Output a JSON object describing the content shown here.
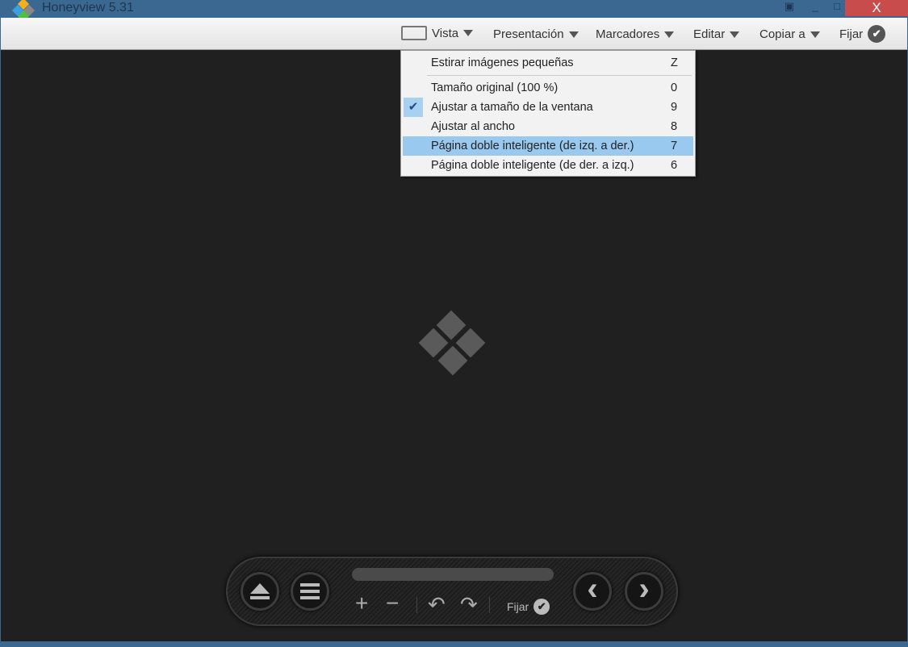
{
  "app": {
    "title": "Honeyview 5.31"
  },
  "window": {
    "close": "X",
    "minimize": "_",
    "maximize": "□",
    "restore": "▣"
  },
  "toolbar": {
    "vista": "Vista",
    "presentacion": "Presentación",
    "marcadores": "Marcadores",
    "editar": "Editar",
    "copiar": "Copiar a",
    "fijar": "Fijar"
  },
  "menu": {
    "items": [
      {
        "label": "Estirar imágenes pequeñas",
        "key": "Z"
      },
      {
        "label": "Tamaño original (100 %)",
        "key": "0"
      },
      {
        "label": "Ajustar a tamaño de la ventana",
        "key": "9",
        "checked": true
      },
      {
        "label": "Ajustar al ancho",
        "key": "8"
      },
      {
        "label": "Página doble inteligente (de izq. a der.)",
        "key": "7",
        "highlighted": true
      },
      {
        "label": "Página doble inteligente (de der. a izq.)",
        "key": "6"
      }
    ]
  },
  "controls": {
    "fijar": "Fijar",
    "zoom_in": "+",
    "zoom_out": "−",
    "rotate_left": "↶",
    "rotate_right": "↷",
    "prev": "‹",
    "next": "›"
  },
  "colors": {
    "titlebar": "#3b6891",
    "highlight": "#99c9ef",
    "close": "#c94c4c",
    "viewer": "#202020"
  }
}
